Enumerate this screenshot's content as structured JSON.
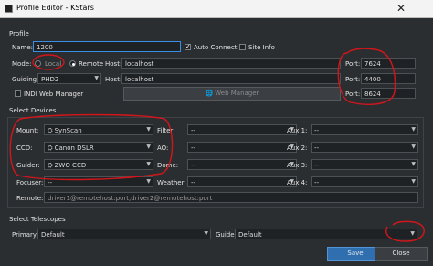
{
  "window": {
    "title": "Profile Editor - KStars",
    "close_glyph": "✕"
  },
  "profile": {
    "section_label": "Profile",
    "name_label": "Name:",
    "name_value": "1200",
    "auto_connect_label": "Auto Connect",
    "auto_connect_checked": true,
    "site_info_label": "Site Info",
    "site_info_checked": false,
    "mode_label": "Mode:",
    "mode_local_label": "Local",
    "mode_remote_label": "Remote",
    "mode_selected": "Remote",
    "host_label": "Host:",
    "host_value": "localhost",
    "port_label": "Port:",
    "port_value": "7624",
    "guiding_label": "Guiding:",
    "guiding_value": "PHD2",
    "guide_host_label": "Host:",
    "guide_host_value": "localhost",
    "guide_port_label": "Port:",
    "guide_port_value": "4400",
    "indi_web_manager_label": "INDI Web Manager",
    "web_manager_button": "Web Manager",
    "web_port_label": "Port:",
    "web_port_value": "8624"
  },
  "devices": {
    "section_label": "Select Devices",
    "mount_label": "Mount:",
    "mount_value": "SynScan",
    "ccd_label": "CCD:",
    "ccd_value": "Canon DSLR",
    "guider_label": "Guider:",
    "guider_value": "ZWO CCD",
    "focuser_label": "Focuser:",
    "focuser_value": "--",
    "filter_label": "Filter:",
    "filter_value": "--",
    "ao_label": "AO:",
    "ao_value": "--",
    "dome_label": "Dome:",
    "dome_value": "--",
    "weather_label": "Weather:",
    "weather_value": "--",
    "aux1_label": "Aux 1:",
    "aux1_value": "--",
    "aux2_label": "Aux 2:",
    "aux2_value": "--",
    "aux3_label": "Aux 3:",
    "aux3_value": "--",
    "aux4_label": "Aux 4:",
    "aux4_value": "--",
    "remote_label": "Remote:",
    "remote_placeholder": "driver1@remotehost:port,driver2@remotehost:port"
  },
  "telescopes": {
    "section_label": "Select Telescopes",
    "primary_label": "Primary:",
    "primary_value": "Default",
    "guide_label": "Guide:",
    "guide_value": "Default"
  },
  "actions": {
    "save": "Save",
    "close": "Close"
  },
  "colors": {
    "background": "#2b2e31",
    "field": "#1f2225",
    "accent": "#3a8ee6",
    "annotation": "#d1161b"
  }
}
